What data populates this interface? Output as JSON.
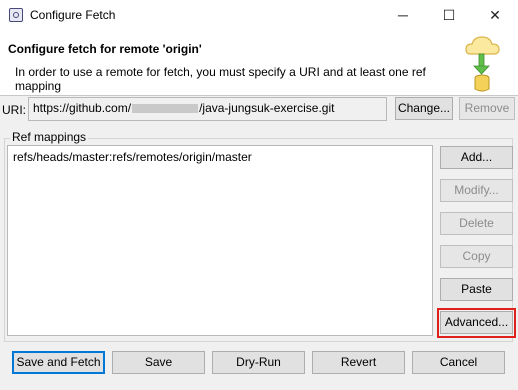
{
  "window": {
    "title": "Configure Fetch",
    "minimize_glyph": "─",
    "maximize_glyph": "☐",
    "close_glyph": "✕"
  },
  "header": {
    "title": "Configure fetch for remote 'origin'",
    "description": "In order to use a remote for fetch, you must specify a URI and at least one ref mapping",
    "icon": "fetch-cloud-database-icon"
  },
  "uri": {
    "label": "URI:",
    "value_prefix": "https://github.com/",
    "value_suffix": "/java-jungsuk-exercise.git",
    "change_label": "Change...",
    "remove_label": "Remove"
  },
  "ref_mappings": {
    "label": "Ref mappings",
    "items": [
      "refs/heads/master:refs/remotes/origin/master"
    ],
    "buttons": {
      "add": "Add...",
      "modify": "Modify...",
      "delete": "Delete",
      "copy": "Copy",
      "paste": "Paste",
      "advanced": "Advanced..."
    }
  },
  "footer": {
    "save_fetch": "Save and Fetch",
    "save": "Save",
    "dry_run": "Dry-Run",
    "revert": "Revert",
    "cancel": "Cancel"
  },
  "colors": {
    "highlight": "#e0201c",
    "default_button_border": "#0078d7"
  }
}
